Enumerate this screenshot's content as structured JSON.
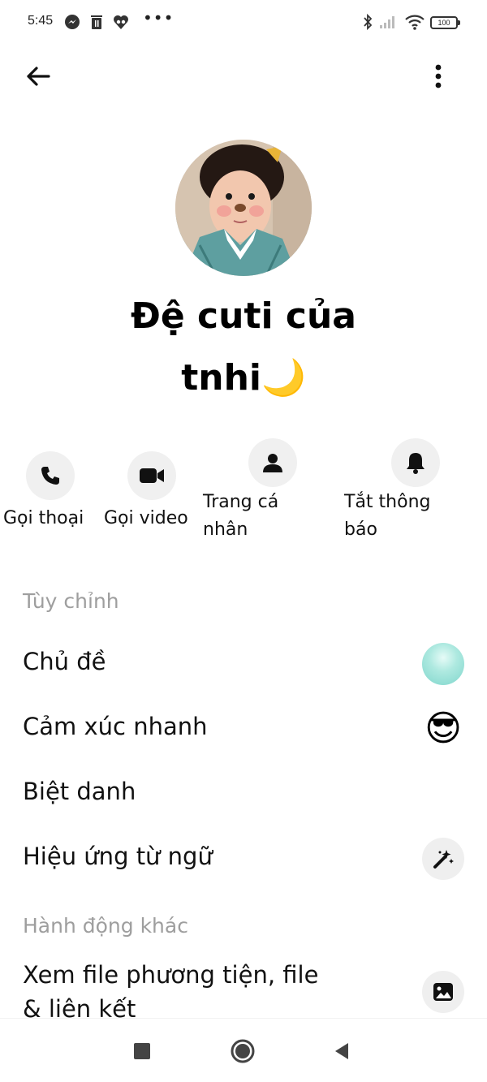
{
  "status_bar": {
    "time": "5:45",
    "battery": "100"
  },
  "header": {
    "back_icon": "arrow-left-icon",
    "more_icon": "vertical-dots-icon"
  },
  "profile": {
    "name_line1": "Đệ cuti của",
    "name_line2": "tnhi🌙"
  },
  "quick_actions": [
    {
      "icon": "phone-icon",
      "label": "Gọi thoại"
    },
    {
      "icon": "video-icon",
      "label": "Gọi video"
    },
    {
      "icon": "person-icon",
      "label_line1": "Trang cá",
      "label_line2": "nhân"
    },
    {
      "icon": "bell-icon",
      "label_line1": "Tắt thông",
      "label_line2": "báo"
    }
  ],
  "customize": {
    "header": "Tùy chỉnh",
    "items": [
      {
        "label": "Chủ đề",
        "trailing": "theme-swatch"
      },
      {
        "label": "Cảm xúc nhanh",
        "trailing_emoji": "😎"
      },
      {
        "label": "Biệt danh"
      },
      {
        "label": "Hiệu ứng từ ngữ",
        "trailing": "magic-wand-icon"
      }
    ]
  },
  "other_actions": {
    "header": "Hành động khác",
    "items": [
      {
        "label_line1": "Xem file phương tiện, file",
        "label_line2": "& liên kết",
        "trailing": "image-icon"
      }
    ]
  },
  "colors": {
    "section_header": "#9e9e9e",
    "icon_circle": "#f0f0f0",
    "text": "#111111"
  }
}
